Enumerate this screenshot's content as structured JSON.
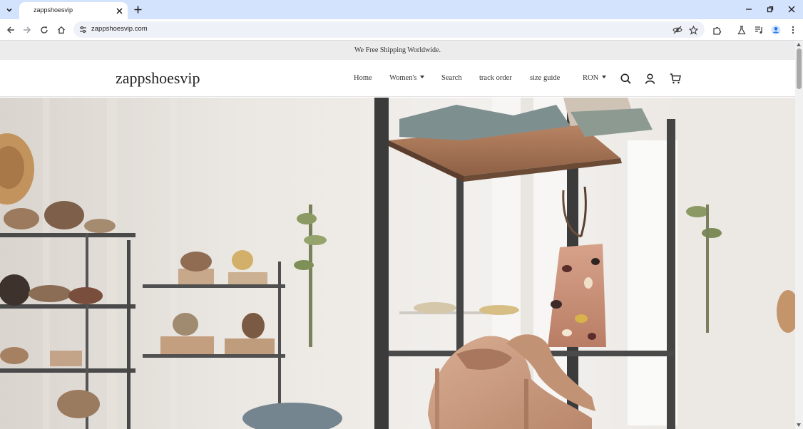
{
  "browser": {
    "tab": {
      "title": "zappshoesvip"
    },
    "address_bar": {
      "url": "zappshoesvip.com"
    },
    "icons": {
      "tab_search": "chevron-down-icon",
      "tab_close": "close-icon",
      "new_tab": "plus-icon",
      "back": "arrow-left-icon",
      "forward": "arrow-right-icon",
      "reload": "reload-icon",
      "home": "home-icon",
      "site_info": "tune-icon",
      "tracking": "eye-off-icon",
      "bookmark": "star-icon",
      "extensions": "puzzle-icon",
      "labs": "flask-icon",
      "media": "queue-music-icon",
      "profile": "account-circle-icon",
      "menu": "kebab-menu-icon"
    },
    "colors": {
      "tabstrip": "#d3e3fd",
      "omnibox": "#eef2f8",
      "profile": "#1a73e8"
    }
  },
  "site": {
    "announcement": "We Free Shipping Worldwide.",
    "logo": "zappshoesvip",
    "nav": {
      "home": "Home",
      "womens": "Women's",
      "search": "Search",
      "track_order": "track order",
      "size_guide": "size guide"
    },
    "currency": "RON",
    "header_icons": [
      "search-icon",
      "account-icon",
      "cart-icon"
    ],
    "hero": {
      "image": "store interior with pink heels on a metal shelf and a patterned handbag",
      "colors": {
        "wall": "#ece8e3",
        "frame": "#3b3b3b",
        "wood": "#a9795a",
        "heels": "#c99b80"
      }
    }
  }
}
